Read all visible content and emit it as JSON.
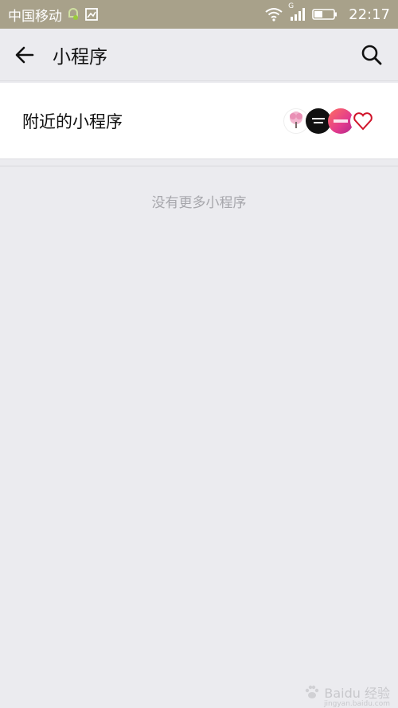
{
  "status_bar": {
    "carrier": "中国移动",
    "time": "22:17",
    "network_label": "G",
    "icons": [
      "notification-icon",
      "image-icon",
      "wifi-icon",
      "signal-icon",
      "battery-icon"
    ]
  },
  "nav": {
    "title": "小程序",
    "back_icon": "arrow-left-icon",
    "search_icon": "search-icon"
  },
  "nearby": {
    "label": "附近的小程序",
    "avatars": [
      "mini-program-avatar-1",
      "mini-program-avatar-2",
      "mini-program-avatar-3",
      "mini-program-avatar-4"
    ]
  },
  "empty": {
    "message": "没有更多小程序"
  },
  "watermark": {
    "brand": "Baidu 经验",
    "url": "jingyan.baidu.com"
  },
  "colors": {
    "status_bar": "#a8a18a",
    "background": "#ebebef",
    "empty_text": "#a6a6ab"
  }
}
